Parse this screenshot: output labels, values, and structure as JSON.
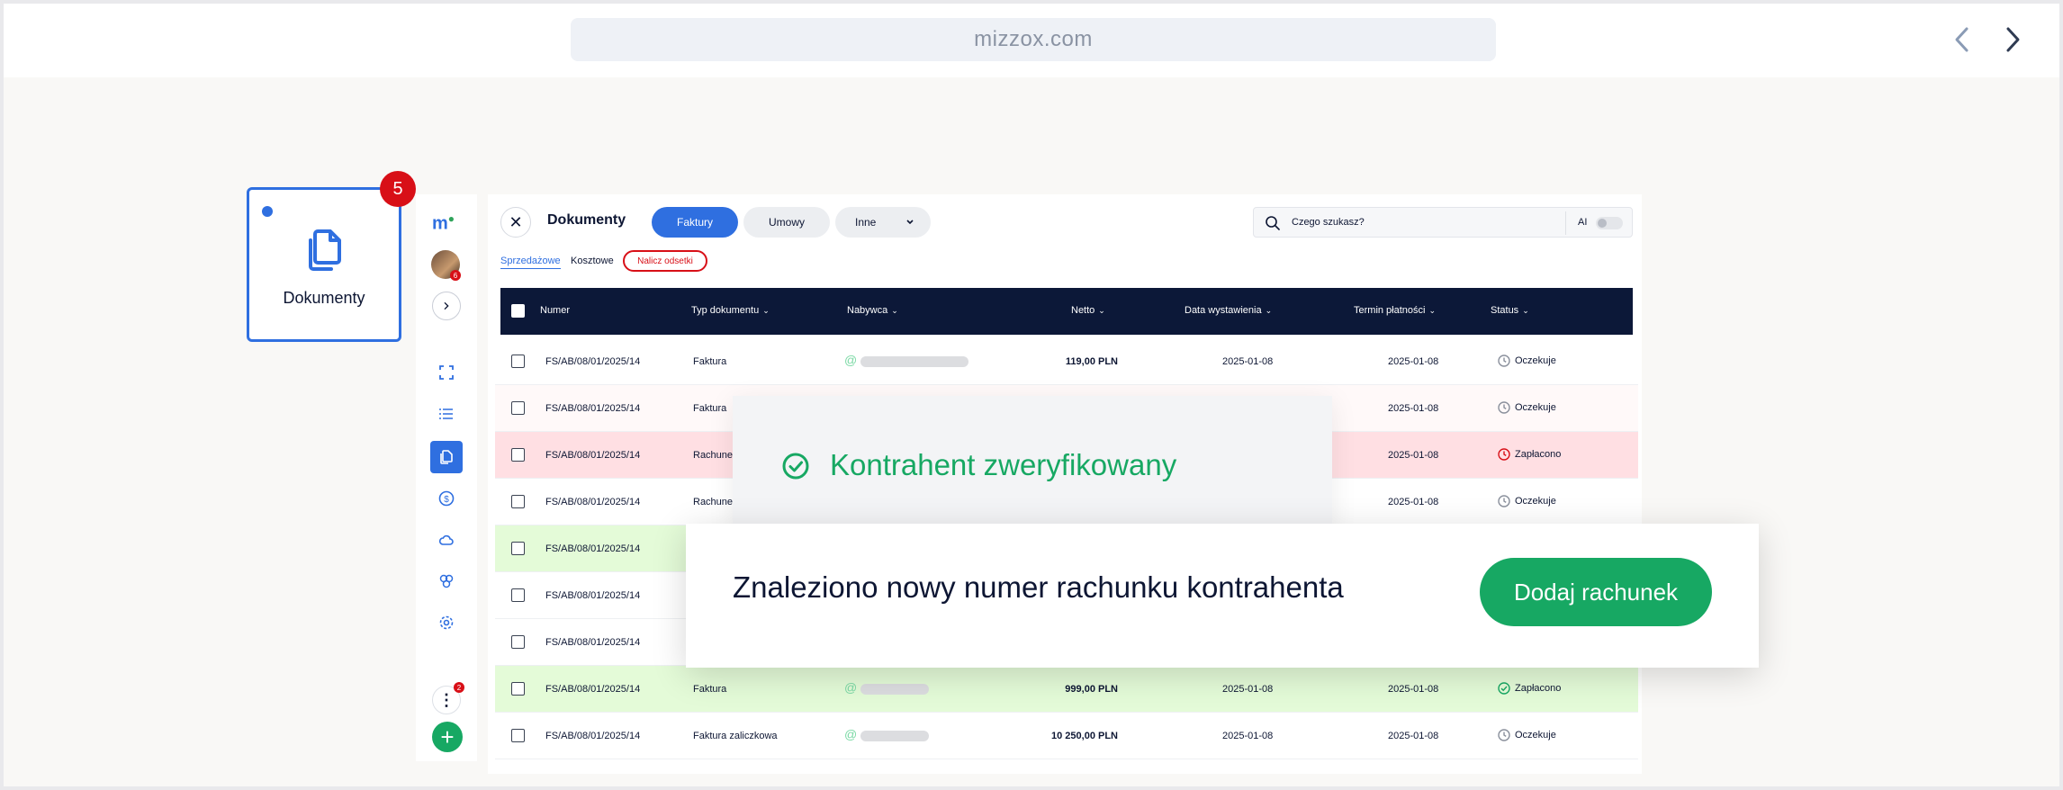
{
  "browser": {
    "url": "mizzox.com"
  },
  "tile": {
    "label": "Dokumenty",
    "badge": "5"
  },
  "sidebar": {
    "logo": "m",
    "avatar_badge": "6",
    "more_badge": "2",
    "add_label": "+"
  },
  "header": {
    "title": "Dokumenty",
    "tabs": [
      "Faktury",
      "Umowy",
      "Inne"
    ],
    "search_placeholder": "Czego szukasz?",
    "ai_label": "AI",
    "subtabs": [
      "Sprzedażowe",
      "Kosztowe"
    ],
    "action_pill": "Nalicz odsetki"
  },
  "table": {
    "columns": [
      "Numer",
      "Typ dokumentu",
      "Nabywca",
      "Netto",
      "Data wystawienia",
      "Termin płatności",
      "Status"
    ],
    "rows": [
      {
        "numer": "FS/AB/08/01/2025/14",
        "typ": "Faktura",
        "netto": "119,00 PLN",
        "data": "2025-01-08",
        "termin": "2025-01-08",
        "status": "Oczekuje"
      },
      {
        "numer": "FS/AB/08/01/2025/14",
        "typ": "Faktura",
        "netto": "",
        "data": "",
        "termin": "2025-01-08",
        "status": "Oczekuje"
      },
      {
        "numer": "FS/AB/08/01/2025/14",
        "typ": "Rachune",
        "netto": "",
        "data": "",
        "termin": "2025-01-08",
        "status": "Zapłacono"
      },
      {
        "numer": "FS/AB/08/01/2025/14",
        "typ": "Rachune",
        "netto": "",
        "data": "",
        "termin": "2025-01-08",
        "status": "Oczekuje"
      },
      {
        "numer": "FS/AB/08/01/2025/14",
        "typ": "",
        "netto": "",
        "data": "",
        "termin": "",
        "status": ""
      },
      {
        "numer": "FS/AB/08/01/2025/14",
        "typ": "",
        "netto": "",
        "data": "",
        "termin": "",
        "status": ""
      },
      {
        "numer": "FS/AB/08/01/2025/14",
        "typ": "",
        "netto": "",
        "data": "",
        "termin": "",
        "status": ""
      },
      {
        "numer": "FS/AB/08/01/2025/14",
        "typ": "Faktura",
        "netto": "999,00 PLN",
        "data": "2025-01-08",
        "termin": "2025-01-08",
        "status": "Zapłacono"
      },
      {
        "numer": "FS/AB/08/01/2025/14",
        "typ": "Faktura zaliczkowa",
        "netto": "10 250,00 PLN",
        "data": "2025-01-08",
        "termin": "2025-01-08",
        "status": "Oczekuje"
      }
    ],
    "buyer_symbol": "@"
  },
  "verified_popup": {
    "text": "Kontrahent zweryfikowany"
  },
  "account_popup": {
    "message": "Znaleziono nowy numer rachunku kontrahenta",
    "button": "Dodaj rachunek"
  },
  "colors": {
    "accent": "#2f6fe0",
    "success": "#17a863",
    "danger": "#d80f17",
    "header_bg": "#0c1838"
  }
}
